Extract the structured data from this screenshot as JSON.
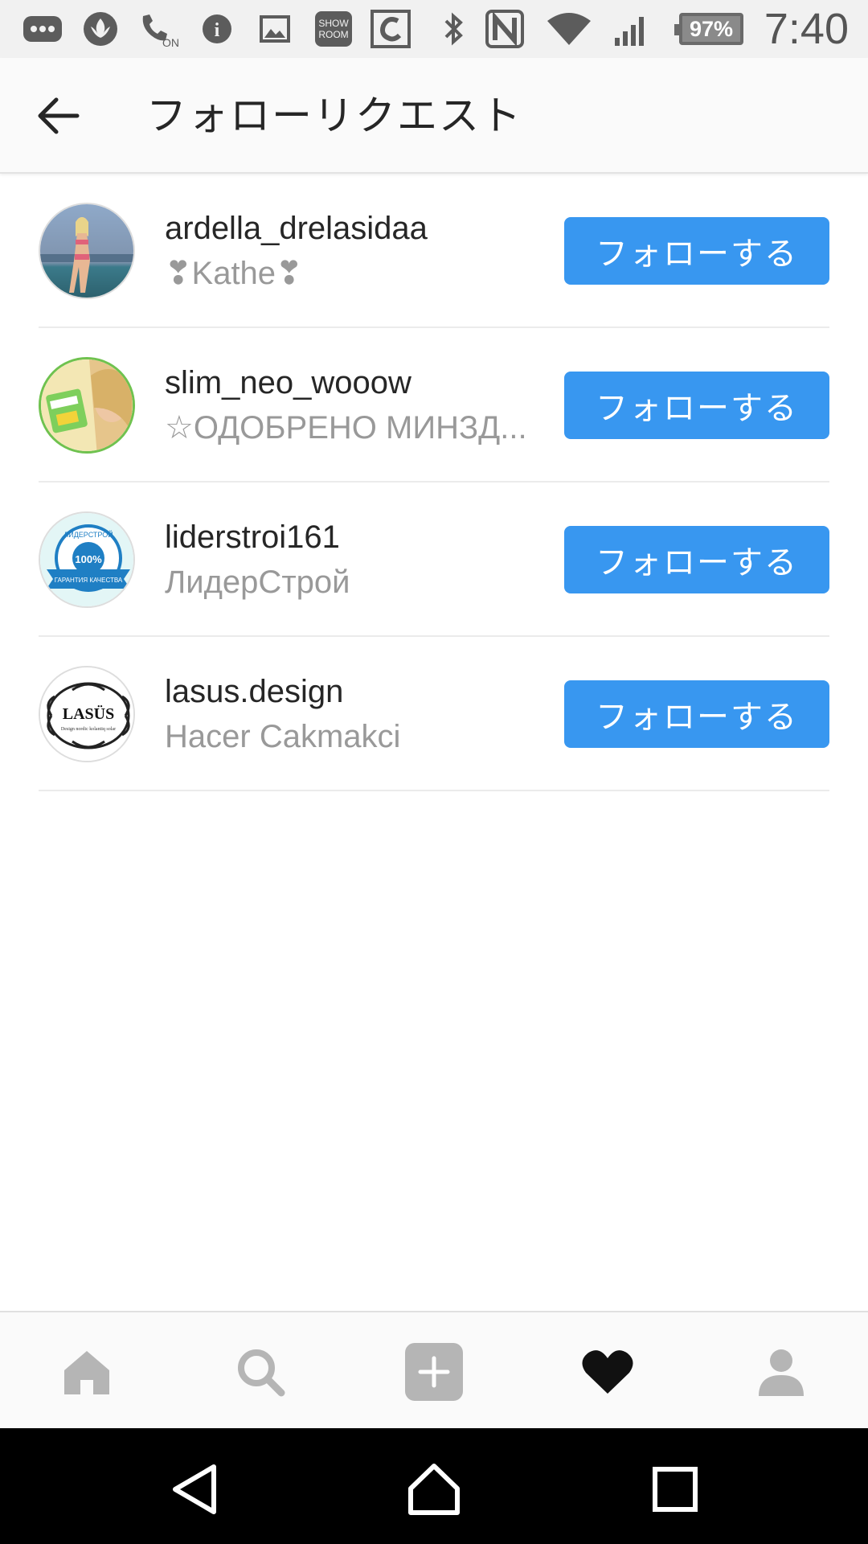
{
  "status_bar": {
    "battery": "97%",
    "time": "7:40",
    "icons": [
      "chat-bubble-icon",
      "lotus-icon",
      "call-on-icon",
      "info-icon",
      "image-icon",
      "showroom-icon",
      "c-app-icon",
      "bluetooth-icon",
      "nfc-icon",
      "wifi-icon",
      "signal-icon"
    ],
    "showroom_label": "SHOW ROOM",
    "call_on_label": "ON",
    "info_label": "i"
  },
  "header": {
    "title": "フォローリクエスト",
    "back_icon": "back-arrow-icon"
  },
  "requests": [
    {
      "username": "ardella_drelasidaa",
      "subname": "❣Kathe❣",
      "button": "フォローする",
      "avatar": "photo-woman-beach"
    },
    {
      "username": "slim_neo_wooow",
      "subname": "☆ОДОБРЕНО МИНЗД...",
      "button": "フォローする",
      "avatar": "photo-woman-product"
    },
    {
      "username": "liderstroi161",
      "subname": "ЛидерСтрой",
      "button": "フォローする",
      "avatar": "badge-logo"
    },
    {
      "username": "lasus.design",
      "subname": "Hacer Cakmakci",
      "button": "フォローする",
      "avatar": "lasus-logo"
    }
  ],
  "avatar_text": {
    "lider_top": "ЛИДЕРСТРОЙ",
    "lider_center": "100%",
    "lider_ribbon": "ГАРАНТИЯ КАЧЕСТВА",
    "lasus": "LASÜS",
    "lasus_tagline": "Design nordic kolantiq solar"
  },
  "tab_bar": {
    "tabs": [
      "home-icon",
      "search-icon",
      "add-icon",
      "heart-icon",
      "profile-icon"
    ],
    "active": "heart-icon"
  },
  "nav_bar": {
    "buttons": [
      "nav-back-icon",
      "nav-home-icon",
      "nav-recents-icon"
    ]
  },
  "colors": {
    "accent": "#3897f0",
    "text_primary": "#262626",
    "text_secondary": "#999999",
    "tab_inactive": "#b5b5b5"
  }
}
